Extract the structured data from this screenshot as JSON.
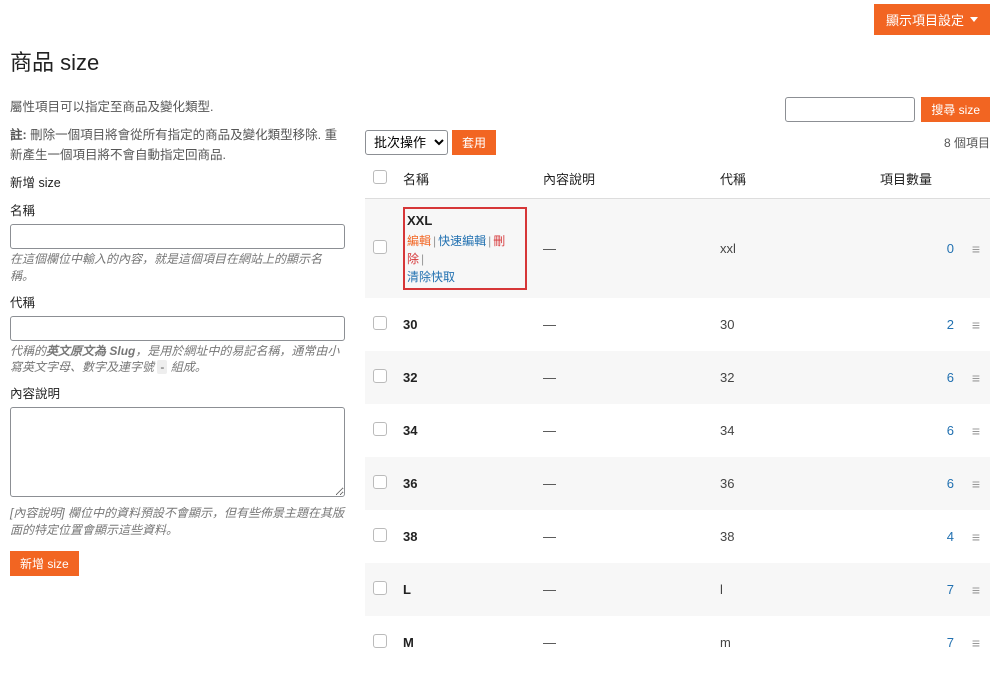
{
  "header": {
    "screen_options": "顯示項目設定"
  },
  "page_title": "商品 size",
  "left": {
    "intro": "屬性項目可以指定至商品及變化類型.",
    "note_label": "註:",
    "note": "刪除一個項目將會從所有指定的商品及變化類型移除. 重新產生一個項目將不會自動指定回商品.",
    "form_title": "新增 size",
    "name_label": "名稱",
    "name_hint": "在這個欄位中輸入的內容，就是這個項目在網站上的顯示名稱。",
    "slug_label": "代稱",
    "slug_hint_pre": "代稱的",
    "slug_hint_em": "英文原文為 Slug",
    "slug_hint_mid": "，是用於網址中的易記名稱，通常由小寫英文字母、數字及連字號",
    "slug_hint_tag": "-",
    "slug_hint_post": "組成。",
    "desc_label": "內容說明",
    "desc_hint": "[內容說明] 欄位中的資料預設不會顯示，但有些佈景主題在其版面的特定位置會顯示這些資料。",
    "submit": "新增 size"
  },
  "right": {
    "search_btn": "搜尋 size",
    "bulk_label": "批次操作",
    "apply": "套用",
    "item_count": "8 個項目",
    "columns": {
      "name": "名稱",
      "desc": "內容說明",
      "slug": "代稱",
      "count": "項目數量"
    },
    "actions": {
      "edit": "編輯",
      "quick": "快速編輯",
      "del": "刪除",
      "cache": "清除快取"
    },
    "rows": [
      {
        "name": "XXL",
        "desc": "—",
        "slug": "xxl",
        "count": "0",
        "hovered": true
      },
      {
        "name": "30",
        "desc": "—",
        "slug": "30",
        "count": "2"
      },
      {
        "name": "32",
        "desc": "—",
        "slug": "32",
        "count": "6"
      },
      {
        "name": "34",
        "desc": "—",
        "slug": "34",
        "count": "6"
      },
      {
        "name": "36",
        "desc": "—",
        "slug": "36",
        "count": "6"
      },
      {
        "name": "38",
        "desc": "—",
        "slug": "38",
        "count": "4"
      },
      {
        "name": "L",
        "desc": "—",
        "slug": "l",
        "count": "7"
      },
      {
        "name": "M",
        "desc": "—",
        "slug": "m",
        "count": "7"
      }
    ]
  }
}
